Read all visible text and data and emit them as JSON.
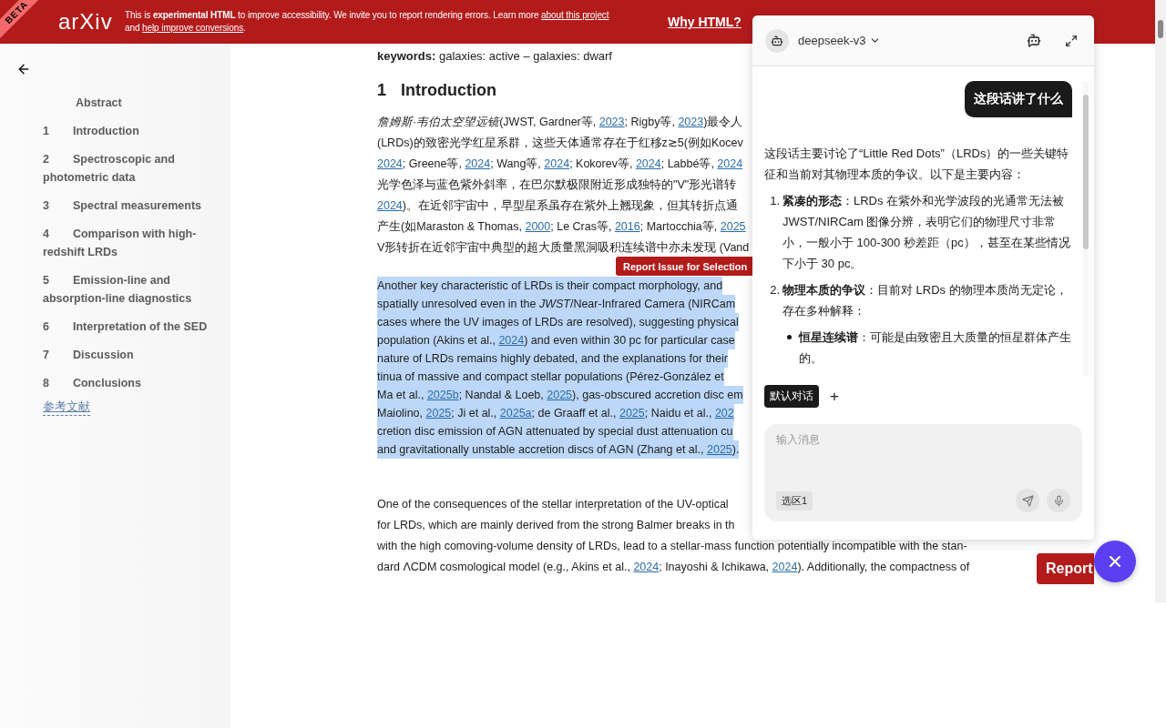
{
  "banner": {
    "badge": "BETA",
    "logo": "arXiv",
    "notice_lines": [
      [
        {
          "kind": "text",
          "text": "This is **experimental HTML** to improve accessibility. We invite you to report rendering errors. Learn more "
        },
        {
          "kind": "link",
          "text": "about this project"
        }
      ],
      [
        {
          "kind": "text",
          "text": "and "
        },
        {
          "kind": "link",
          "text": "help improve conversions"
        },
        {
          "kind": "text",
          "text": "."
        }
      ]
    ],
    "why_link": "Why HTML?"
  },
  "sidebar": {
    "toc": [
      {
        "title": "Abstract"
      },
      {
        "number": "1",
        "title": "Introduction"
      },
      {
        "number": "2",
        "title": "Spectroscopic and photometric data"
      },
      {
        "number": "3",
        "title": "Spectral measurements"
      },
      {
        "number": "4",
        "title": "Comparison with high-redshift LRDs"
      },
      {
        "number": "5",
        "title": "Emission-line and absorption-line diagnostics"
      },
      {
        "number": "6",
        "title": "Interpretation of the SED"
      },
      {
        "number": "7",
        "title": "Discussion"
      },
      {
        "number": "8",
        "title": "Conclusions"
      }
    ],
    "references": "参考文献"
  },
  "article": {
    "keywords": "**keywords:** galaxies: active – galaxies: dwarf",
    "section": {
      "number": "1",
      "title": "Introduction"
    },
    "report_selection": "Report Issue for Selection",
    "paragraphs": [
      {
        "selected": false,
        "lines": [
          [
            {
              "kind": "text",
              "text": "*詹姆斯·韦伯太空望远镜*(JWST, Gardner等, "
            },
            {
              "kind": "link",
              "text": "2023"
            },
            {
              "kind": "text",
              "text": "; Rigby等, "
            },
            {
              "kind": "link",
              "text": "2023"
            },
            {
              "kind": "text",
              "text": ")最令人"
            }
          ],
          [
            {
              "kind": "text",
              "text": "(LRDs)的致密光学红星系群，这些天体通常存在于红移z≳5(例如Kocev"
            }
          ],
          [
            {
              "kind": "link",
              "text": "2024"
            },
            {
              "kind": "text",
              "text": "; Greene等, "
            },
            {
              "kind": "link",
              "text": "2024"
            },
            {
              "kind": "text",
              "text": "; Wang等, "
            },
            {
              "kind": "link",
              "text": "2024"
            },
            {
              "kind": "text",
              "text": "; Kokorev等, "
            },
            {
              "kind": "link",
              "text": "2024"
            },
            {
              "kind": "text",
              "text": "; Labbé等, "
            },
            {
              "kind": "link",
              "text": "2024"
            }
          ],
          [
            {
              "kind": "text",
              "text": "光学色泽与蓝色紫外斜率，在巴尔默极限附近形成独特的\"V\"形光谱转"
            }
          ],
          [
            {
              "kind": "link",
              "text": "2024"
            },
            {
              "kind": "text",
              "text": ")。在近邻宇宙中，早型星系虽存在紫外上翘现象，但其转折点通"
            }
          ],
          [
            {
              "kind": "text",
              "text": "产生(如Maraston & Thomas, "
            },
            {
              "kind": "link",
              "text": "2000"
            },
            {
              "kind": "text",
              "text": "; Le Cras等, "
            },
            {
              "kind": "link",
              "text": "2016"
            },
            {
              "kind": "text",
              "text": "; Martocchia等, "
            },
            {
              "kind": "link",
              "text": "2025"
            }
          ],
          [
            {
              "kind": "text",
              "text": "V形转折在近邻宇宙中典型的超大质量黑洞吸积连续谱中亦未发现 (Vand"
            }
          ]
        ]
      },
      {
        "selected": true,
        "lines": [
          [
            {
              "kind": "text",
              "text": "Another key characteristic of LRDs is their compact morphology, and"
            }
          ],
          [
            {
              "kind": "text",
              "text": "spatially unresolved even in the *JWST*/Near-Infrared Camera (NIRCam"
            }
          ],
          [
            {
              "kind": "text",
              "text": "cases where the UV images of LRDs are resolved), suggesting physical"
            }
          ],
          [
            {
              "kind": "text",
              "text": "population (Akins et al., "
            },
            {
              "kind": "link",
              "text": "2024"
            },
            {
              "kind": "text",
              "text": ") and even within 30 pc for particular case"
            }
          ],
          [
            {
              "kind": "text",
              "text": "nature of LRDs remains highly debated, and the explanations for their"
            }
          ],
          [
            {
              "kind": "text",
              "text": "tinua of massive and compact stellar populations (Pérez-González et"
            }
          ],
          [
            {
              "kind": "text",
              "text": "Ma et al., "
            },
            {
              "kind": "link",
              "text": "2025b"
            },
            {
              "kind": "text",
              "text": "; Nandal & Loeb, "
            },
            {
              "kind": "link",
              "text": "2025"
            },
            {
              "kind": "text",
              "text": "), gas-obscured accretion disc em"
            }
          ],
          [
            {
              "kind": "text",
              "text": "Maiolino, "
            },
            {
              "kind": "link",
              "text": "2025"
            },
            {
              "kind": "text",
              "text": "; Ji et al., "
            },
            {
              "kind": "link",
              "text": "2025a"
            },
            {
              "kind": "text",
              "text": "; de Graaff et al., "
            },
            {
              "kind": "link",
              "text": "2025"
            },
            {
              "kind": "text",
              "text": "; Naidu et al., "
            },
            {
              "kind": "link",
              "text": "202"
            }
          ],
          [
            {
              "kind": "text",
              "text": "cretion disc emission of AGN attenuated by special dust attenuation cu"
            }
          ],
          [
            {
              "kind": "text",
              "text": "and gravitationally unstable accretion discs of AGN (Zhang et al., "
            },
            {
              "kind": "link",
              "text": "2025"
            },
            {
              "kind": "text",
              "text": ")."
            }
          ]
        ]
      },
      {
        "selected": false,
        "lines": [
          [
            {
              "kind": "text",
              "text": "One of the consequences of the stellar interpretation of the UV-optical"
            }
          ],
          [
            {
              "kind": "text",
              "text": "for LRDs, which are mainly derived from the strong Balmer breaks in th"
            }
          ],
          [
            {
              "kind": "text",
              "text": "with the high comoving-volume density of LRDs, lead to a stellar-mass function potentially incompatible with the stan-"
            }
          ],
          [
            {
              "kind": "text",
              "text": "dard ΛCDM cosmological model (e.g., Akins et al., "
            },
            {
              "kind": "link",
              "text": "2024"
            },
            {
              "kind": "text",
              "text": "; Inayoshi & Ichikawa, "
            },
            {
              "kind": "link",
              "text": "2024"
            },
            {
              "kind": "text",
              "text": "). Additionally, the compactness of"
            }
          ]
        ]
      }
    ]
  },
  "report_button": "Report",
  "chat": {
    "model": "deepseek-v3",
    "user_message": "这段话讲了什么",
    "reply": {
      "intro": "这段话主要讨论了“Little Red Dots”（LRDs）的一些关键特征和当前对其物理本质的争议。以下是主要内容：",
      "items": [
        {
          "number": "1.",
          "title": "紧凑的形态",
          "text": "：LRDs 在紫外和光学波段的光通常无法被 JWST/NIRCam 图像分辨，表明它们的物理尺寸非常小，一般小于 100-300 秒差距（pc），甚至在某些情况下小于 30 pc。"
        },
        {
          "number": "2.",
          "title": "物理本质的争议",
          "text": "：目前对 LRDs 的物理本质尚无定论，存在多种解释：",
          "children": [
            {
              "title": "恒星连续谱",
              "text": "：可能是由致密且大质量的恒星群体产生的。"
            }
          ]
        }
      ]
    },
    "tabs": [
      {
        "label": "默认对话",
        "selected": true
      }
    ],
    "add_tab": "+",
    "input": {
      "placeholder": "输入消息",
      "chip": "选区1"
    }
  }
}
